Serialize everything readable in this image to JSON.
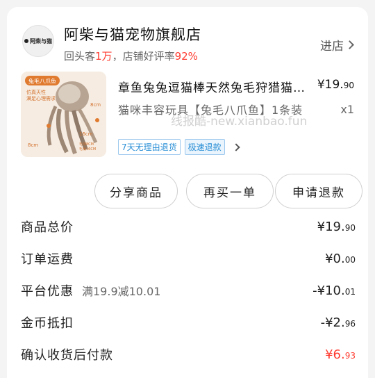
{
  "store": {
    "logo_text": "阿柴与猫",
    "name": "阿柴与猫宠物旗舰店",
    "repeat_label": "回头客",
    "repeat_value": "1万",
    "rating_label": "，店铺好评率",
    "rating_value": "92%",
    "link_label": "进店"
  },
  "product": {
    "title": "章鱼兔兔逗猫棒天然兔毛狩猎猫咪丰容玩具",
    "price_main": "¥19.",
    "price_cents": "90",
    "spec": "猫咪丰容玩具【兔毛八爪鱼】1条装",
    "qty": "x1",
    "image_labels": [
      "兔毛八爪鱼",
      "仿真天性",
      "满足心理需求",
      "8cm",
      "16cm",
      "8cm",
      "毛球8CM",
      "毛柄16CM"
    ],
    "watermark": "线报酷-new.xianbao.fun",
    "tags": [
      "7天无理由退货",
      "极速退款"
    ]
  },
  "actions": {
    "share": "分享商品",
    "rebuy": "再买一单",
    "refund": "申请退款"
  },
  "summary": [
    {
      "label": "商品总价",
      "note": "",
      "amount_main": "¥19.",
      "amount_cents": "90",
      "red": false
    },
    {
      "label": "订单运费",
      "note": "",
      "amount_main": "¥0.",
      "amount_cents": "00",
      "red": false
    },
    {
      "label": "平台优惠",
      "note": "满19.9减10.01",
      "amount_main": "-¥10.",
      "amount_cents": "01",
      "red": false
    },
    {
      "label": "金币抵扣",
      "note": "",
      "amount_main": "-¥2.",
      "amount_cents": "96",
      "red": false
    },
    {
      "label": "确认收货后付款",
      "note": "",
      "amount_main": "¥6.",
      "amount_cents": "93",
      "red": true
    }
  ],
  "colors": {
    "accent_red": "#ff3b30",
    "tag_blue": "#2a8fd6"
  }
}
